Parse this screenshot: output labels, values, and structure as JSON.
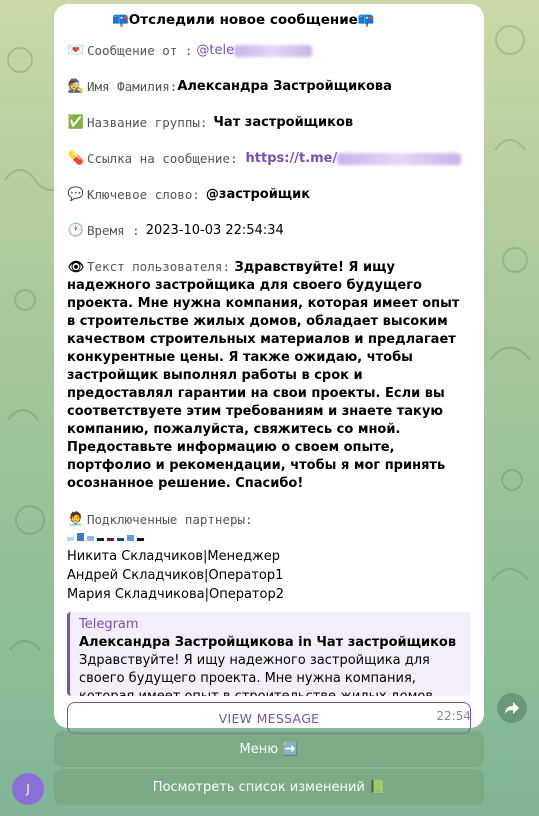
{
  "message": {
    "title": "📪Отследили новое сообщение📪",
    "sender_label": "Сообщение от :",
    "sender_value": "@tele",
    "name_label": "Имя Фамилия:",
    "name_value": "Александра Застройщикова",
    "group_label": "Название группы:",
    "group_value": "Чат застройщиков",
    "link_label": "Ссылка на сообщение:",
    "link_value": "https://t.me/",
    "keyword_label": "Ключевое слово:",
    "keyword_value": "@застройщик",
    "time_label": "Время  :",
    "time_value": "2023-10-03 22:54:34",
    "text_label": "Текст пользователя:",
    "text_value": "Здравствуйте! Я ищу надежного застройщика для своего будущего проекта. Мне нужна компания, которая имеет опыт в строительстве жилых домов, обладает высоким качеством строительных материалов и предлагает конкурентные цены. Я также ожидаю, чтобы застройщик выполнял работы в срок и предоставлял гарантии на свои проекты. Если вы соответствуете этим требованиям и знаете такую компанию, пожалуйста, свяжитесь со мной. Предоставьте информацию о своем опыте, портфолио и рекомендации, чтобы я мог принять осознанное решение. Спасибо!",
    "partners_label": "Подключенные партнеры:",
    "partners": [
      "Никита Складчиков|Менеджер",
      "Андрей Складчиков|Оператор1",
      "Мария Складчикова|Оператор2"
    ],
    "preview": {
      "source": "Telegram",
      "title": "Александра Застройщикова in Чат застройщиков",
      "body": "Здравствуйте! Я ищу надежного застройщика для своего будущего проекта. Мне нужна компания, которая имеет опыт в строительстве жилых домов, обладает высоким качество..."
    },
    "view_button": "VIEW MESSAGE",
    "sent_time": "22:54"
  },
  "keyboard": {
    "menu_button": "Меню ➡️",
    "changes_button": "Посмотреть список изменений 📗"
  },
  "avatar_letter": "J",
  "colors": {
    "accent": "#7b4fb0",
    "bubble": "#ffffff"
  }
}
